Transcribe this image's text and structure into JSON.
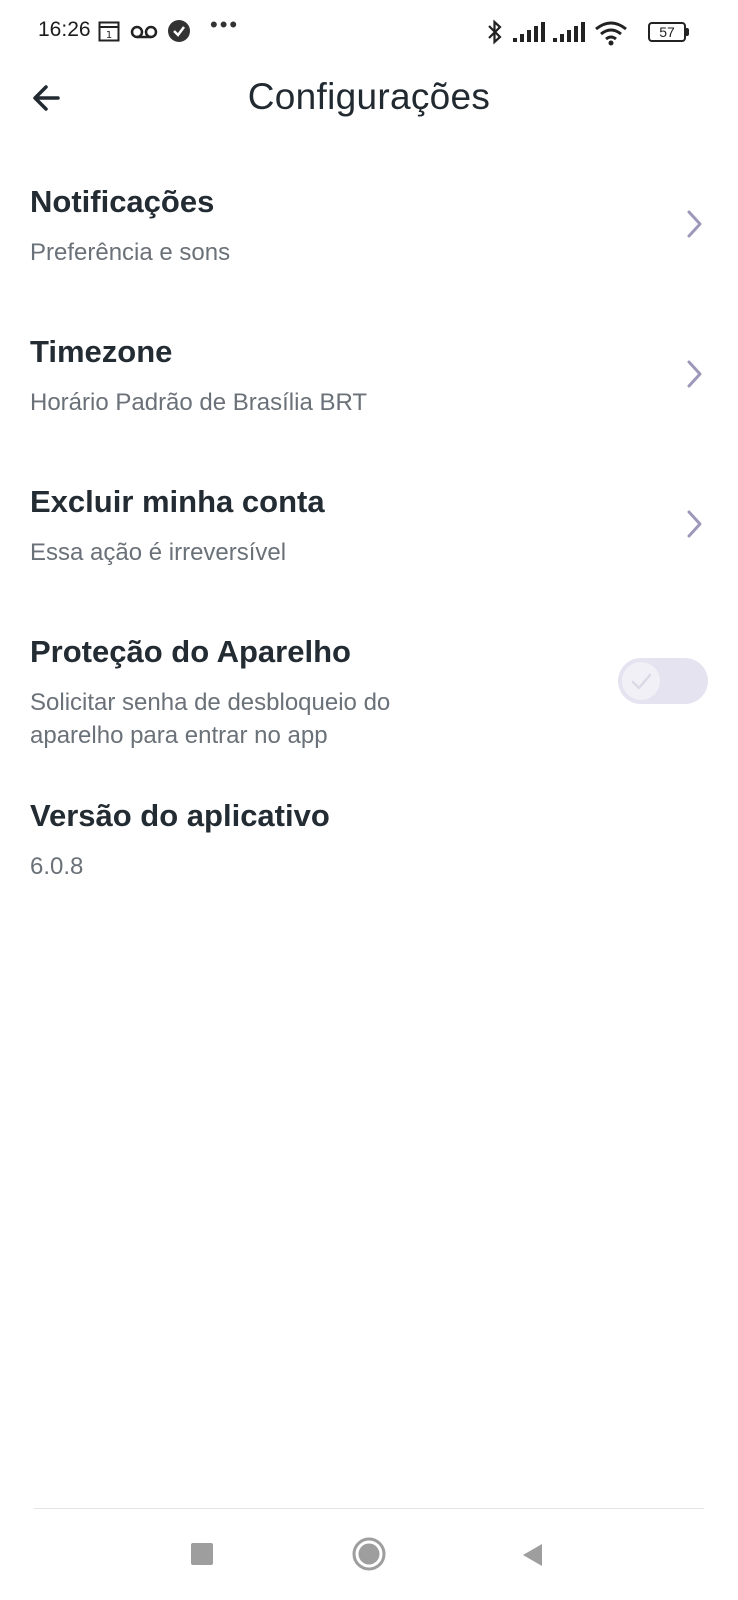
{
  "status_bar": {
    "time": "16:26",
    "calendar_day": "1",
    "battery": "57"
  },
  "header": {
    "title": "Configurações"
  },
  "settings": {
    "notifications": {
      "title": "Notificações",
      "subtitle": "Preferência e sons"
    },
    "timezone": {
      "title": "Timezone",
      "subtitle": "Horário Padrão de Brasília BRT"
    },
    "delete_account": {
      "title": "Excluir minha conta",
      "subtitle": "Essa ação é irreversível"
    },
    "device_protection": {
      "title": "Proteção do Aparelho",
      "subtitle_line1": "Solicitar senha de desbloqueio do",
      "subtitle_line2": "aparelho para entrar no app",
      "enabled": false
    },
    "app_version": {
      "title": "Versão do aplicativo",
      "value": "6.0.8"
    }
  },
  "colors": {
    "title_text": "#232b33",
    "subtitle_text": "#6a7178",
    "chevron": "#9d98b9",
    "toggle_track": "#e6e3f0"
  }
}
